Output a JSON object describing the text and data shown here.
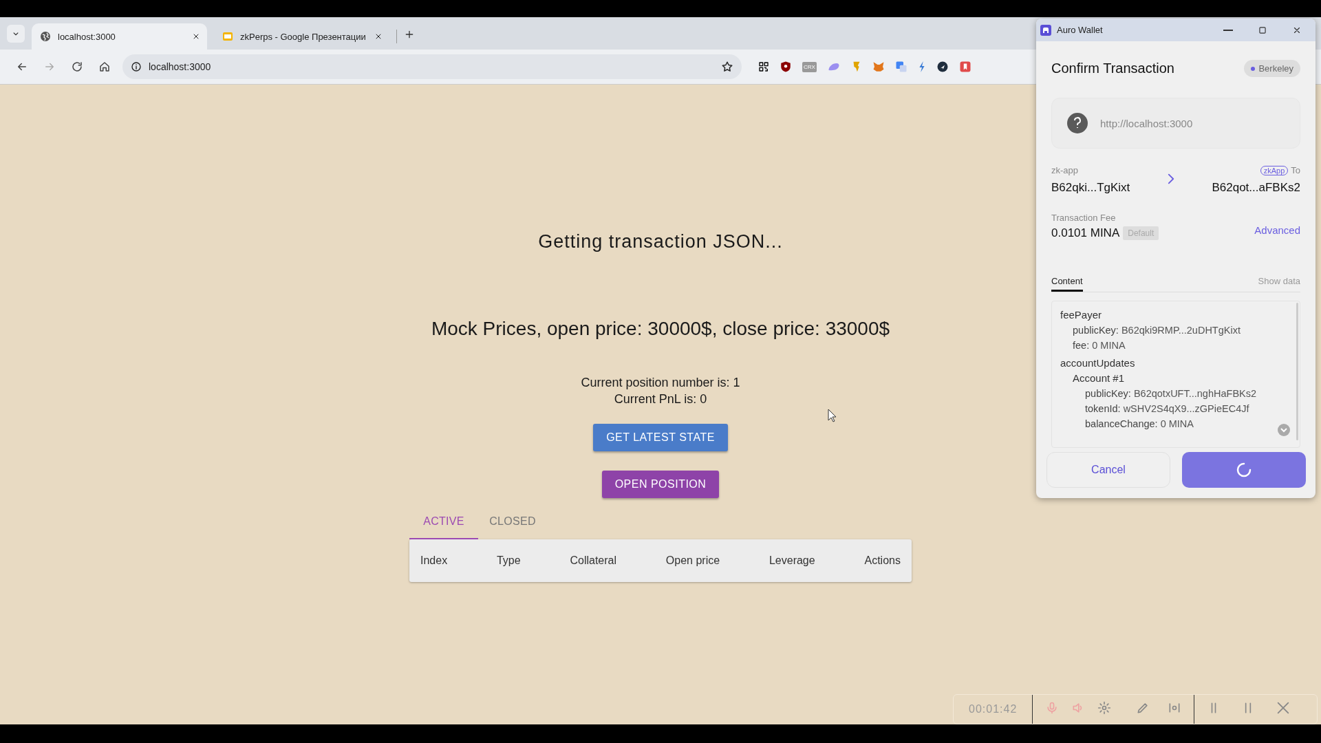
{
  "browser": {
    "tabs": [
      {
        "title": "localhost:3000",
        "selected": true,
        "kind": "globe"
      },
      {
        "title": "zkPerps - Google Презентации",
        "selected": false,
        "kind": "slides"
      }
    ],
    "address": "localhost:3000",
    "extension_label": "CRX"
  },
  "page": {
    "status": "Getting transaction JSON...",
    "prices": "Mock Prices, open price: 30000$, close price: 33000$",
    "position_number": "Current position number is: 1",
    "pnl": "Current PnL is: 0",
    "buttons": [
      {
        "label": "GET LATEST STATE",
        "kind": "primary"
      },
      {
        "label": "OPEN POSITION",
        "kind": "secondary"
      }
    ],
    "tabs": [
      {
        "label": "ACTIVE",
        "selected": true
      },
      {
        "label": "CLOSED",
        "selected": false
      }
    ],
    "table": {
      "columns": [
        "Index",
        "Type",
        "Collateral",
        "Open price",
        "Leverage",
        "Actions"
      ]
    }
  },
  "wallet": {
    "window_title": "Auro Wallet",
    "heading": "Confirm Transaction",
    "network": "Berkeley",
    "origin": "http://localhost:3000",
    "from_label": "zk-app",
    "from": "B62qki...TgKixt",
    "to_badge": "zkApp",
    "to_label": "To",
    "to": "B62qot...aFBKs2",
    "fee_label": "Transaction Fee",
    "fee": "0.0101 MINA",
    "fee_badge": "Default",
    "advanced": "Advanced",
    "content_tabs": [
      {
        "label": "Content",
        "selected": true
      },
      {
        "label": "Show data",
        "selected": false
      }
    ],
    "tree": [
      {
        "label": "feePayer",
        "children": [
          {
            "label": "publicKey:",
            "value": "B62qki9RMP...2uDHTgKixt"
          },
          {
            "label": "fee:",
            "value": "0 MINA"
          }
        ]
      },
      {
        "label": "accountUpdates",
        "children": [
          {
            "label": "Account #1",
            "children": [
              {
                "label": "publicKey:",
                "value": "B62qotxUFT...nghHaFBKs2"
              },
              {
                "label": "tokenId:",
                "value": "wSHV2S4qX9...zGPieEC4Jf"
              },
              {
                "label": "balanceChange:",
                "value": "0 MINA"
              }
            ]
          }
        ]
      }
    ],
    "cancel": "Cancel",
    "confirm_loading": true
  },
  "recorder": {
    "time": "00:01:42"
  }
}
